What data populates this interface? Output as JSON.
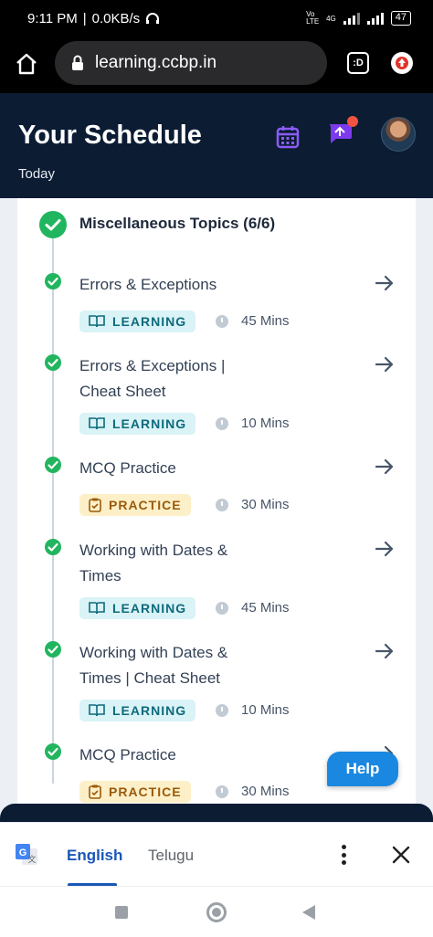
{
  "status_bar": {
    "time": "9:11 PM",
    "speed": "0.0KB/s",
    "network": "4G",
    "volte": "Vo LTE",
    "battery": "47"
  },
  "browser": {
    "url": "learning.ccbp.in",
    "tabs_label": ":D"
  },
  "header": {
    "title": "Your Schedule",
    "subtitle": "Today"
  },
  "section": {
    "title": "Miscellaneous Topics (6/6)"
  },
  "items": [
    {
      "title": "Errors & Exceptions",
      "tag": "LEARNING",
      "duration": "45 Mins"
    },
    {
      "title": "Errors & Exceptions | Cheat Sheet",
      "tag": "LEARNING",
      "duration": "10 Mins"
    },
    {
      "title": "MCQ Practice",
      "tag": "PRACTICE",
      "duration": "30 Mins"
    },
    {
      "title": "Working with Dates & Times",
      "tag": "LEARNING",
      "duration": "45 Mins"
    },
    {
      "title": "Working with Dates & Times | Cheat Sheet",
      "tag": "LEARNING",
      "duration": "10 Mins"
    },
    {
      "title": "MCQ Practice",
      "tag": "PRACTICE",
      "duration": "30 Mins"
    }
  ],
  "help_label": "Help",
  "translate": {
    "lang_active": "English",
    "lang_other": "Telugu"
  },
  "colors": {
    "header_bg": "#0b1c33",
    "check_green": "#22b55f",
    "learning_bg": "#d9f3f7",
    "practice_bg": "#fdf0c8",
    "help_blue": "#1a88e0"
  }
}
